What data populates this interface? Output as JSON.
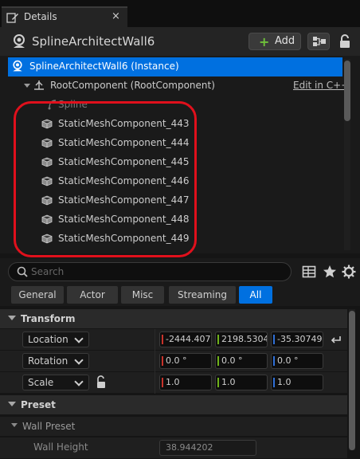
{
  "tab": {
    "title": "Details",
    "close": "×"
  },
  "header": {
    "actor_name": "SplineArchitectWall6",
    "add_label": "Add",
    "add_plus": "+"
  },
  "tree": {
    "instance": "SplineArchitectWall6 (Instance)",
    "root": "RootComponent (RootComponent)",
    "edit_link": "Edit in C++",
    "spline": "Spline",
    "components": [
      "StaticMeshComponent_443",
      "StaticMeshComponent_444",
      "StaticMeshComponent_445",
      "StaticMeshComponent_446",
      "StaticMeshComponent_447",
      "StaticMeshComponent_448",
      "StaticMeshComponent_449"
    ],
    "annotation_color": "#e0101c"
  },
  "search": {
    "placeholder": "Search"
  },
  "filters": [
    "General",
    "Actor",
    "Misc",
    "Streaming",
    "All"
  ],
  "active_filter": "All",
  "transform": {
    "title": "Transform",
    "location": {
      "label": "Location",
      "x": "-2444.4072",
      "y": "2198.5304",
      "z": "-35.307492"
    },
    "rotation": {
      "label": "Rotation",
      "x": "0.0 °",
      "y": "0.0 °",
      "z": "0.0 °"
    },
    "scale": {
      "label": "Scale",
      "x": "1.0",
      "y": "1.0",
      "z": "1.0"
    }
  },
  "preset": {
    "title": "Preset",
    "wall_preset": "Wall Preset",
    "wall_height_label": "Wall Height",
    "wall_height_value": "38.944202"
  },
  "colors": {
    "accent": "#0070e0",
    "x_axis": "#c8332b",
    "y_axis": "#6fb21b",
    "z_axis": "#2f6fd6",
    "add_plus": "#6fc13a"
  }
}
